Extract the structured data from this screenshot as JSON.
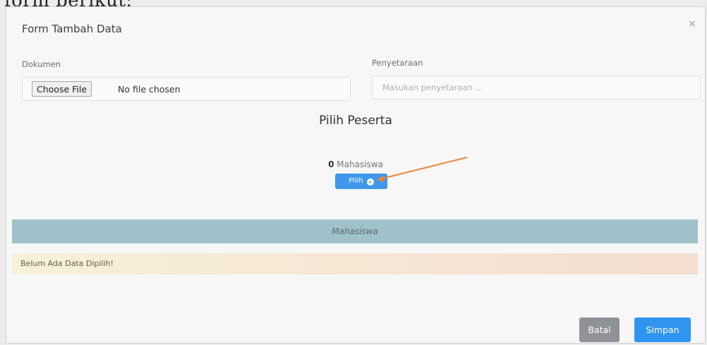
{
  "page_caption": "form berikut:",
  "modal": {
    "title": "Form Tambah Data",
    "close_symbol": "×"
  },
  "form": {
    "dokumen_label": "Dokumen",
    "choose_file_label": "Choose File",
    "file_status": "No file chosen",
    "penyetaraan_label": "Penyetaraan",
    "penyetaraan_placeholder": "Masukan penyetaraan ...",
    "penyetaraan_value": ""
  },
  "peserta": {
    "section_title": "Pilih Peserta",
    "count": "0",
    "count_label": "Mahasiswa",
    "pilih_label": "Pilih",
    "pilih_icon": "plus-circle-icon"
  },
  "table": {
    "header": "Mahasiswa",
    "empty_message": "Belum Ada Data Dipilih!"
  },
  "footer": {
    "batal_label": "Batal",
    "simpan_label": "Simpan"
  },
  "colors": {
    "primary": "#2f95ef",
    "secondary": "#8f9296",
    "table_header": "#9fc1c9",
    "annotation_arrow": "#e8853a"
  }
}
